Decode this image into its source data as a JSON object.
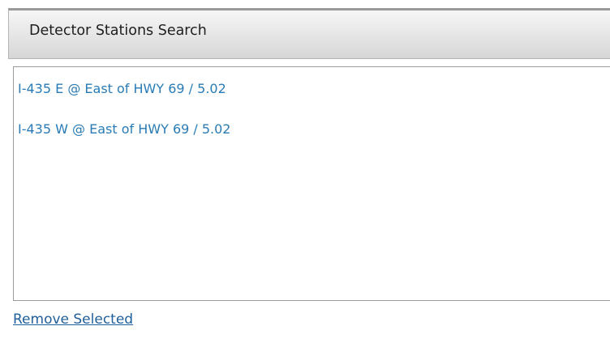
{
  "panel": {
    "title": "Detector Stations Search"
  },
  "list": {
    "items": [
      {
        "label": "I-435 E @ East of HWY 69 / 5.02"
      },
      {
        "label": "I-435 W @ East of HWY 69 / 5.02"
      }
    ]
  },
  "actions": {
    "remove_selected": "Remove Selected"
  },
  "colors": {
    "item_text": "#2a7bb5",
    "link_text": "#1f5f99",
    "header_gradient_top": "#f6f6f6",
    "header_gradient_bottom": "#d6d6d6"
  }
}
